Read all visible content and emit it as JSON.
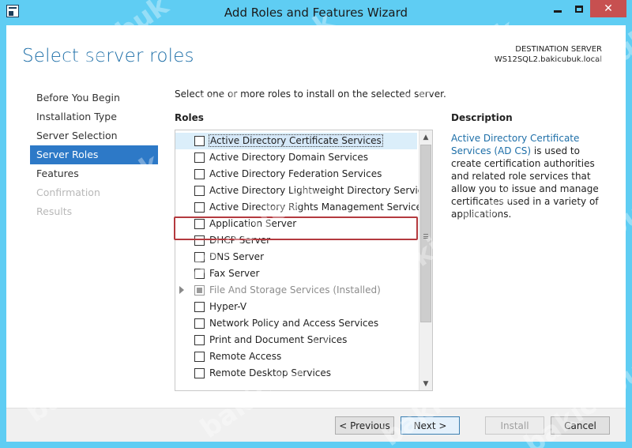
{
  "window": {
    "title": "Add Roles and Features Wizard",
    "icons": {
      "app": "server-manager-icon",
      "min": "minimize-icon",
      "max": "maximize-icon",
      "close": "close-icon"
    },
    "close_glyph": "✕"
  },
  "header": {
    "heading": "Select server roles",
    "destination_label": "DESTINATION SERVER",
    "destination_server": "WS12SQL2.bakicubuk.local"
  },
  "nav": {
    "items": [
      {
        "label": "Before You Begin",
        "state": "normal"
      },
      {
        "label": "Installation Type",
        "state": "normal"
      },
      {
        "label": "Server Selection",
        "state": "normal"
      },
      {
        "label": "Server Roles",
        "state": "active"
      },
      {
        "label": "Features",
        "state": "normal"
      },
      {
        "label": "Confirmation",
        "state": "disabled"
      },
      {
        "label": "Results",
        "state": "disabled"
      }
    ]
  },
  "main": {
    "instruction": "Select one or more roles to install on the selected server.",
    "roles_label": "Roles",
    "roles": [
      {
        "label": "Active Directory Certificate Services",
        "checked": false,
        "selected": true
      },
      {
        "label": "Active Directory Domain Services",
        "checked": false
      },
      {
        "label": "Active Directory Federation Services",
        "checked": false
      },
      {
        "label": "Active Directory Lightweight Directory Services",
        "checked": false
      },
      {
        "label": "Active Directory Rights Management Services",
        "checked": false
      },
      {
        "label": "Application Server",
        "checked": false,
        "highlighted": true
      },
      {
        "label": "DHCP Server",
        "checked": false
      },
      {
        "label": "DNS Server",
        "checked": false
      },
      {
        "label": "Fax Server",
        "checked": false
      },
      {
        "label": "File And Storage Services (Installed)",
        "checked": "partial",
        "expandable": true,
        "installed": true
      },
      {
        "label": "Hyper-V",
        "checked": false
      },
      {
        "label": "Network Policy and Access Services",
        "checked": false
      },
      {
        "label": "Print and Document Services",
        "checked": false
      },
      {
        "label": "Remote Access",
        "checked": false
      },
      {
        "label": "Remote Desktop Services",
        "checked": false
      }
    ],
    "scroll_up": "▲",
    "scroll_down": "▼"
  },
  "description": {
    "title": "Description",
    "link": "Active Directory Certificate Services (AD CS)",
    "text": " is used to create certification authorities and related role services that allow you to issue and manage certificates used in a variety of applications."
  },
  "footer": {
    "previous": "< Previous",
    "next": "Next >",
    "install": "Install",
    "cancel": "Cancel"
  },
  "watermark": "bakicubuk",
  "colors": {
    "title_bar": "#5fcdf3",
    "accent": "#1e6fa8",
    "nav_active": "#2d79c7",
    "highlight_box": "#b43a3f"
  }
}
